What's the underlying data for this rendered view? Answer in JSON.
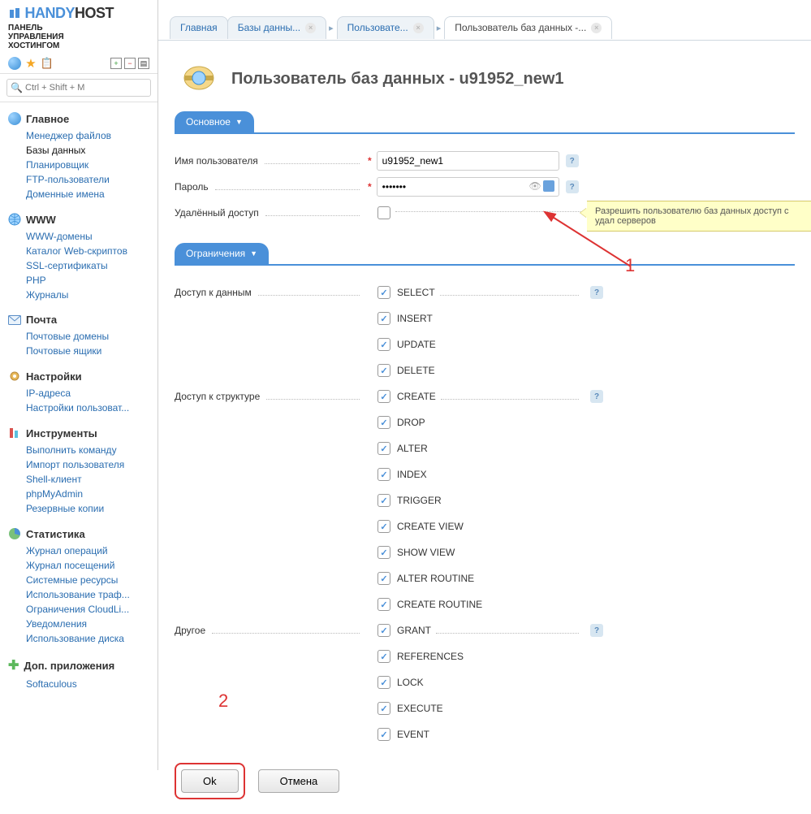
{
  "brand": {
    "name_a": "HANDY",
    "name_b": "HOST",
    "sub1": "ПАНЕЛЬ",
    "sub2": "УПРАВЛЕНИЯ",
    "sub3": "ХОСТИНГОМ"
  },
  "search": {
    "placeholder": "Ctrl + Shift + M"
  },
  "nav": {
    "main": {
      "title": "Главное",
      "items": [
        "Менеджер файлов",
        "Базы данных",
        "Планировщик",
        "FTP-пользователи",
        "Доменные имена"
      ],
      "active_index": 1
    },
    "www": {
      "title": "WWW",
      "items": [
        "WWW-домены",
        "Каталог Web-скриптов",
        "SSL-сертификаты",
        "PHP",
        "Журналы"
      ]
    },
    "mail": {
      "title": "Почта",
      "items": [
        "Почтовые домены",
        "Почтовые ящики"
      ]
    },
    "settings": {
      "title": "Настройки",
      "items": [
        "IP-адреса",
        "Настройки пользоват..."
      ]
    },
    "tools": {
      "title": "Инструменты",
      "items": [
        "Выполнить команду",
        "Импорт пользователя",
        "Shell-клиент",
        "phpMyAdmin",
        "Резервные копии"
      ]
    },
    "stats": {
      "title": "Статистика",
      "items": [
        "Журнал операций",
        "Журнал посещений",
        "Системные ресурсы",
        "Использование траф...",
        "Ограничения CloudLi...",
        "Уведомления",
        "Использование диска"
      ]
    },
    "addons": {
      "title": "Доп. приложения",
      "items": [
        "Softaculous"
      ]
    }
  },
  "tabs": {
    "t0": "Главная",
    "t1": "Базы данны...",
    "t2": "Пользовате...",
    "t3": "Пользователь баз данных -..."
  },
  "page": {
    "title": "Пользователь баз данных - u91952_new1"
  },
  "sections": {
    "main": "Основное",
    "limits": "Ограничения"
  },
  "form": {
    "username_label": "Имя пользователя",
    "username_value": "u91952_new1",
    "password_label": "Пароль",
    "password_value": "•••••••",
    "remote_label": "Удалённый доступ",
    "data_label": "Доступ к данным",
    "structure_label": "Доступ к структуре",
    "other_label": "Другое"
  },
  "perms_data": [
    "SELECT",
    "INSERT",
    "UPDATE",
    "DELETE"
  ],
  "perms_structure": [
    "CREATE",
    "DROP",
    "ALTER",
    "INDEX",
    "TRIGGER",
    "CREATE VIEW",
    "SHOW VIEW",
    "ALTER ROUTINE",
    "CREATE ROUTINE"
  ],
  "perms_other": [
    "GRANT",
    "REFERENCES",
    "LOCK",
    "EXECUTE",
    "EVENT"
  ],
  "buttons": {
    "ok": "Ok",
    "cancel": "Отмена"
  },
  "tooltip": "Разрешить пользователю баз данных доступ с удал серверов",
  "annotations": {
    "a1": "1",
    "a2": "2"
  }
}
